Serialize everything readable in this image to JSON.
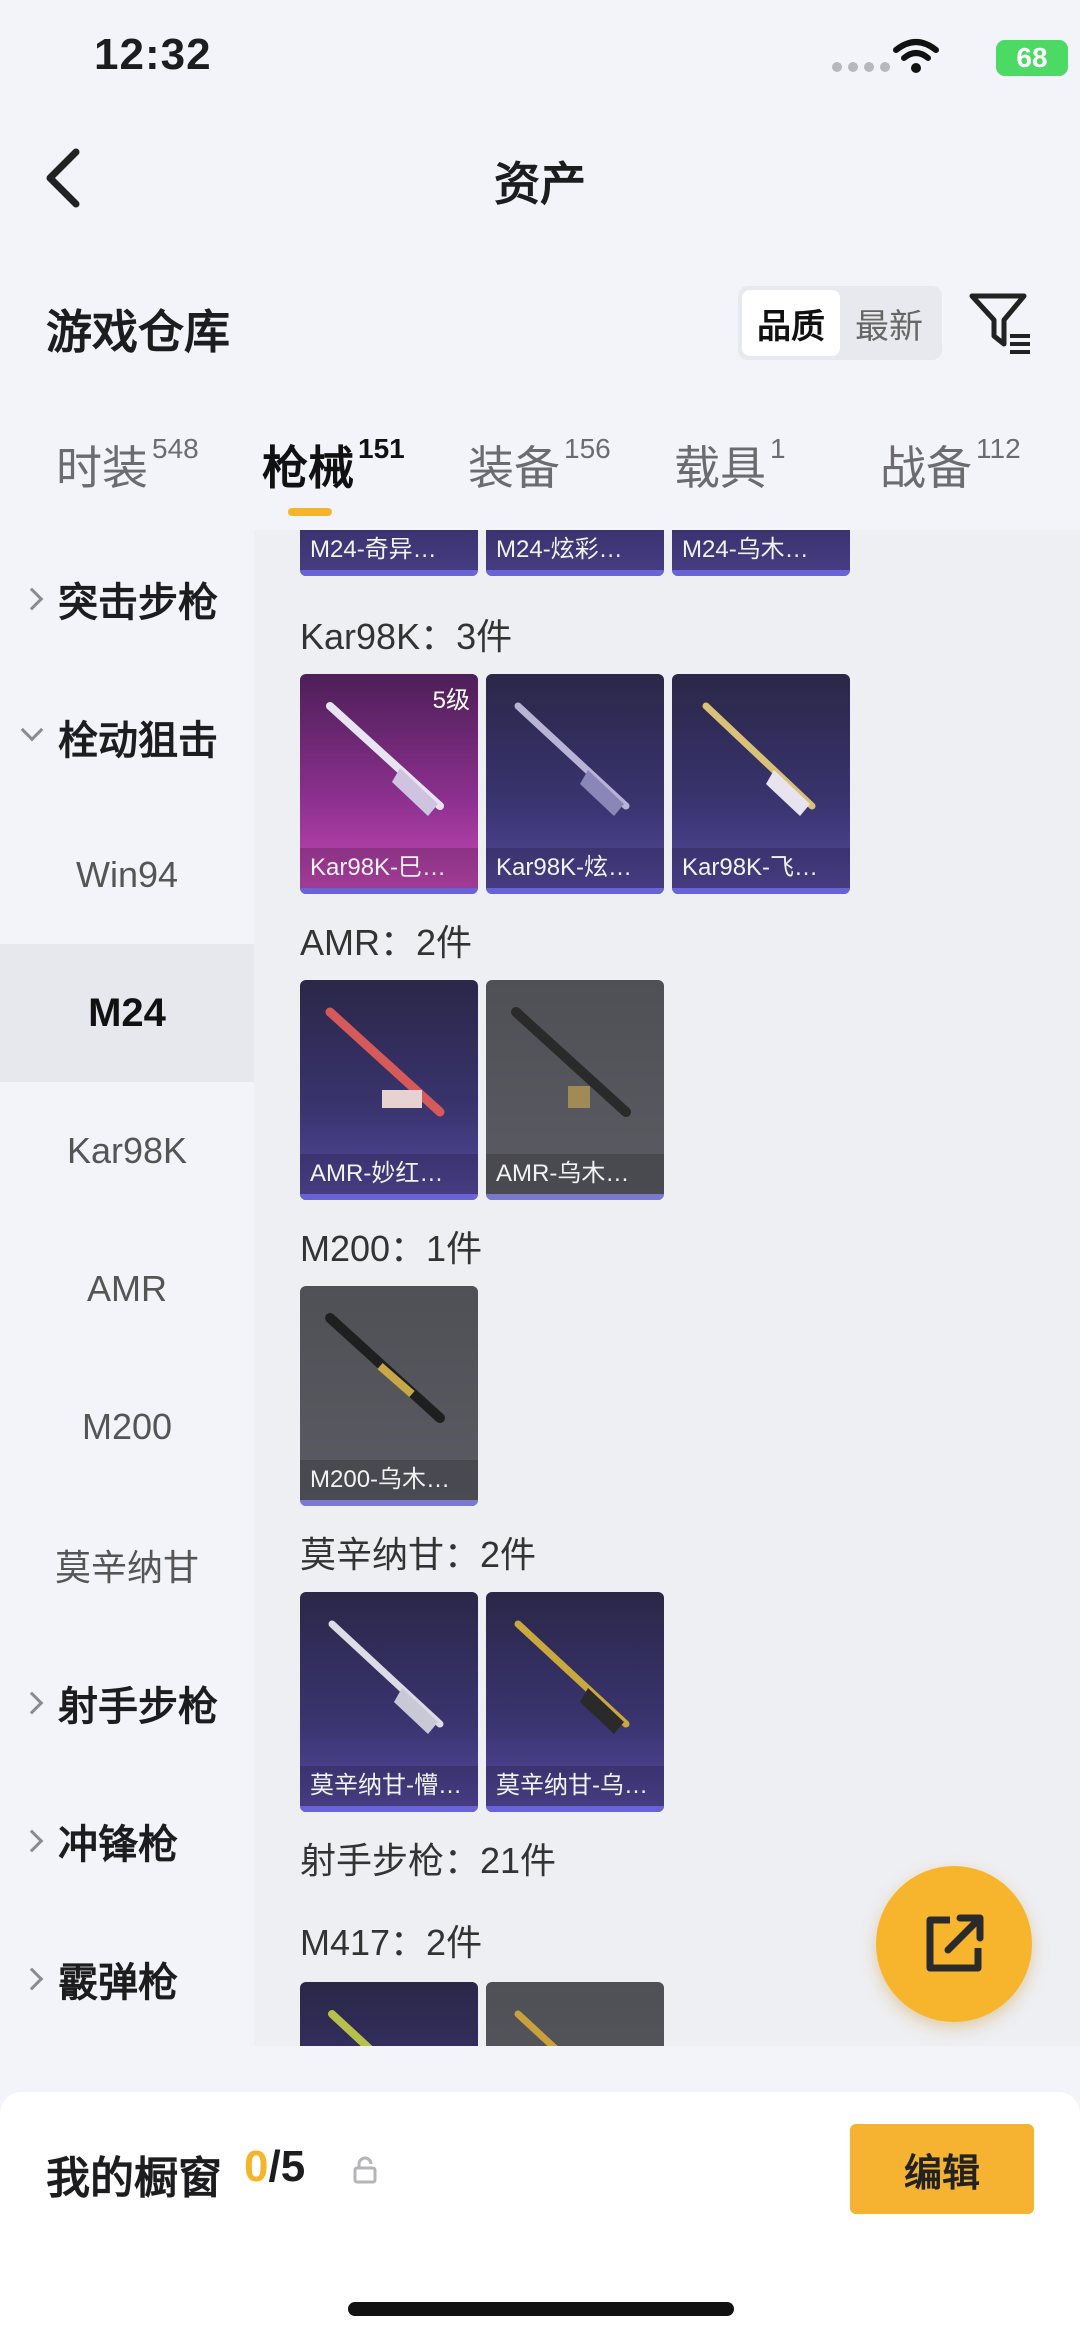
{
  "status_bar": {
    "time": "12:32",
    "battery": "68"
  },
  "nav": {
    "title": "资产"
  },
  "warehouse": {
    "title": "游戏仓库",
    "sort_options": [
      "品质",
      "最新"
    ],
    "sort_active": "品质"
  },
  "tabs": [
    {
      "label": "时装",
      "count": "548"
    },
    {
      "label": "枪械",
      "count": "151"
    },
    {
      "label": "装备",
      "count": "156"
    },
    {
      "label": "载具",
      "count": "1"
    },
    {
      "label": "战备",
      "count": "112"
    }
  ],
  "sidebar": [
    {
      "label": "突击步枪",
      "kind": "category",
      "expanded": false
    },
    {
      "label": "栓动狙击",
      "kind": "category",
      "expanded": true
    },
    {
      "label": "Win94",
      "kind": "sub"
    },
    {
      "label": "M24",
      "kind": "sub",
      "selected": true
    },
    {
      "label": "Kar98K",
      "kind": "sub"
    },
    {
      "label": "AMR",
      "kind": "sub"
    },
    {
      "label": "M200",
      "kind": "sub"
    },
    {
      "label": "莫辛纳甘",
      "kind": "sub"
    },
    {
      "label": "射手步枪",
      "kind": "category",
      "expanded": false
    },
    {
      "label": "冲锋枪",
      "kind": "category",
      "expanded": false
    },
    {
      "label": "霰弹枪",
      "kind": "category",
      "expanded": false
    }
  ],
  "content": {
    "top_partial": [
      "M24-奇异…",
      "M24-炫彩…",
      "M24-乌木…"
    ],
    "groups": [
      {
        "heading": "Kar98K：3件",
        "items": [
          {
            "name": "Kar98K-巳…",
            "level": "5级",
            "style": "pink"
          },
          {
            "name": "Kar98K-炫…",
            "style": "purple"
          },
          {
            "name": "Kar98K-飞…",
            "style": "purple"
          }
        ]
      },
      {
        "heading": "AMR：2件",
        "items": [
          {
            "name": "AMR-妙红…",
            "style": "purple"
          },
          {
            "name": "AMR-乌木…",
            "style": "grey"
          }
        ]
      },
      {
        "heading": "M200：1件",
        "items": [
          {
            "name": "M200-乌木…",
            "style": "grey"
          }
        ]
      },
      {
        "heading": "莫辛纳甘：2件",
        "items": [
          {
            "name": "莫辛纳甘-懵…",
            "style": "purple"
          },
          {
            "name": "莫辛纳甘-乌…",
            "style": "purple"
          }
        ]
      }
    ],
    "section_heading": "射手步枪：21件",
    "subgroup_heading": "M417：2件"
  },
  "showcase": {
    "title": "我的橱窗",
    "current": "0",
    "total": "/5",
    "edit_label": "编辑"
  },
  "icons": [
    "back-icon",
    "filter-icon",
    "share-icon",
    "lock-icon",
    "wifi-icon"
  ],
  "colors": {
    "accent": "#f5b52a",
    "card_purple": "#3a3470",
    "card_pink": "#8a2f8d",
    "card_grey": "#5b5c63"
  }
}
